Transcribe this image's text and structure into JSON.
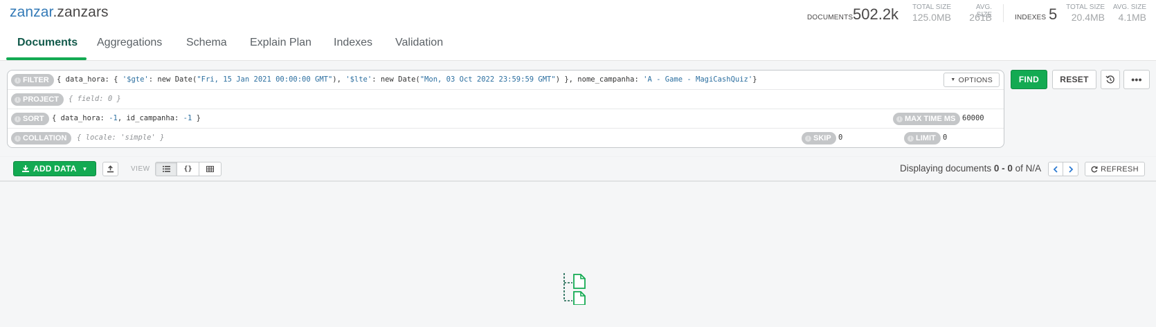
{
  "namespace": {
    "database": "zanzar",
    "separator": ".",
    "collection": "zanzars"
  },
  "stats": {
    "documents_label": "DOCUMENTS",
    "documents_value": "502.2k",
    "doc_total_size_label": "TOTAL SIZE",
    "doc_total_size_value": "125.0MB",
    "doc_avg_size_label": "AVG. SIZE",
    "doc_avg_size_value": "261B",
    "indexes_label": "INDEXES",
    "indexes_value": "5",
    "idx_total_size_label": "TOTAL SIZE",
    "idx_total_size_value": "20.4MB",
    "idx_avg_size_label": "AVG. SIZE",
    "idx_avg_size_value": "4.1MB"
  },
  "tabs": [
    {
      "label": "Documents",
      "active": true
    },
    {
      "label": "Aggregations"
    },
    {
      "label": "Schema"
    },
    {
      "label": "Explain Plan"
    },
    {
      "label": "Indexes"
    },
    {
      "label": "Validation"
    }
  ],
  "query": {
    "filter_label": "FILTER",
    "filter_p1": "{ data_hora: { ",
    "filter_s1": "'$gte'",
    "filter_p2": ": new Date(",
    "filter_s2": "\"Fri, 15 Jan 2021 00:00:00 GMT\"",
    "filter_p3": "), ",
    "filter_s3": "'$lte'",
    "filter_p4": ": new Date(",
    "filter_s4": "\"Mon, 03 Oct 2022 23:59:59 GMT\"",
    "filter_p5": ") }, nome_campanha: ",
    "filter_s5": "'A - Game - MagiCashQuiz'",
    "filter_p6": "}",
    "options_label": "OPTIONS",
    "project_label": "PROJECT",
    "project_placeholder": "{ field: 0 }",
    "sort_label": "SORT",
    "sort_p1": "{ data_hora: ",
    "sort_n1": "-1",
    "sort_p2": ", id_campanha: ",
    "sort_n2": "-1",
    "sort_p3": " }",
    "max_time_label": "MAX TIME MS",
    "max_time_value": "60000",
    "collation_label": "COLLATION",
    "collation_placeholder": "{ locale: 'simple' }",
    "skip_label": "SKIP",
    "skip_value": "0",
    "limit_label": "LIMIT",
    "limit_value": "0"
  },
  "buttons": {
    "find": "FIND",
    "reset": "RESET",
    "more": "•••"
  },
  "toolbar": {
    "add_data": "ADD DATA",
    "view_label": "VIEW",
    "displaying_prefix": "Displaying documents ",
    "displaying_range": "0 - 0",
    "displaying_suffix": " of N/A",
    "refresh": "REFRESH"
  },
  "colors": {
    "accent_green": "#13aa52",
    "db_blue": "#337ab7",
    "json_string": "#2c6fa0"
  },
  "icons": [
    "history-icon",
    "download-icon",
    "export-icon",
    "list-view-icon",
    "json-view-icon",
    "table-view-icon",
    "chevron-left-icon",
    "chevron-right-icon",
    "refresh-icon",
    "empty-documents-icon"
  ]
}
